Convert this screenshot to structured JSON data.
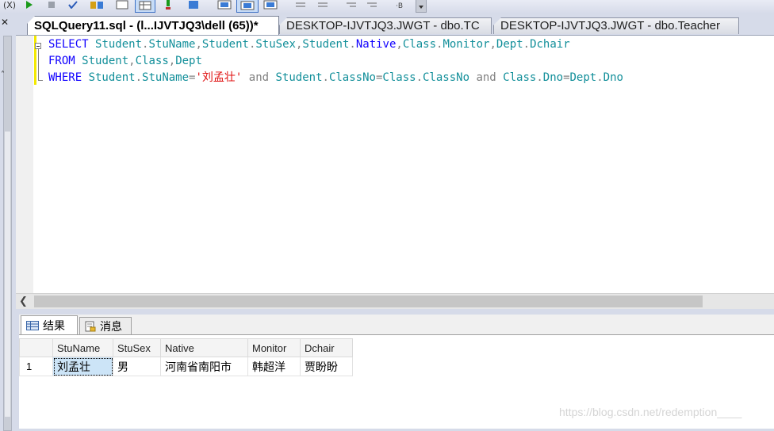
{
  "toolbar": {
    "cut_label": "(X)",
    "icons": [
      "execute-icon",
      "stop-icon",
      "parse-icon",
      "plan-icon",
      "results-to-text-icon",
      "results-to-grid-icon",
      "results-to-file-icon",
      "include-plan-icon",
      "comment-icon",
      "uncomment-icon",
      "decrease-indent-icon",
      "increase-indent-icon",
      "specify-values-icon"
    ]
  },
  "tabs": [
    {
      "label": "SQLQuery11.sql - (l...IJVTJQ3\\dell (65))*",
      "active": true
    },
    {
      "label": "DESKTOP-IJVTJQ3.JWGT - dbo.TC",
      "active": false
    },
    {
      "label": "DESKTOP-IJVTJQ3.JWGT - dbo.Teacher",
      "active": false
    }
  ],
  "editor": {
    "lines": [
      [
        {
          "t": "SELECT ",
          "c": "kw"
        },
        {
          "t": "Student",
          "c": "id"
        },
        {
          "t": ".",
          "c": "op"
        },
        {
          "t": "StuName",
          "c": "id"
        },
        {
          "t": ",",
          "c": "op"
        },
        {
          "t": "Student",
          "c": "id"
        },
        {
          "t": ".",
          "c": "op"
        },
        {
          "t": "StuSex",
          "c": "id"
        },
        {
          "t": ",",
          "c": "op"
        },
        {
          "t": "Student",
          "c": "id"
        },
        {
          "t": ".",
          "c": "op"
        },
        {
          "t": "Native",
          "c": "kw"
        },
        {
          "t": ",",
          "c": "op"
        },
        {
          "t": "Class",
          "c": "id"
        },
        {
          "t": ".",
          "c": "op"
        },
        {
          "t": "Monitor",
          "c": "id"
        },
        {
          "t": ",",
          "c": "op"
        },
        {
          "t": "Dept",
          "c": "id"
        },
        {
          "t": ".",
          "c": "op"
        },
        {
          "t": "Dchair",
          "c": "id"
        }
      ],
      [
        {
          "t": "FROM ",
          "c": "kw"
        },
        {
          "t": "Student",
          "c": "id"
        },
        {
          "t": ",",
          "c": "op"
        },
        {
          "t": "Class",
          "c": "id"
        },
        {
          "t": ",",
          "c": "op"
        },
        {
          "t": "Dept",
          "c": "id"
        }
      ],
      [
        {
          "t": "WHERE ",
          "c": "kw"
        },
        {
          "t": "Student",
          "c": "id"
        },
        {
          "t": ".",
          "c": "op"
        },
        {
          "t": "StuName",
          "c": "id"
        },
        {
          "t": "=",
          "c": "op"
        },
        {
          "t": "'刘孟壮'",
          "c": "str"
        },
        {
          "t": " and ",
          "c": "op"
        },
        {
          "t": "Student",
          "c": "id"
        },
        {
          "t": ".",
          "c": "op"
        },
        {
          "t": "ClassNo",
          "c": "id"
        },
        {
          "t": "=",
          "c": "op"
        },
        {
          "t": "Class",
          "c": "id"
        },
        {
          "t": ".",
          "c": "op"
        },
        {
          "t": "ClassNo",
          "c": "id"
        },
        {
          "t": " and ",
          "c": "op"
        },
        {
          "t": "Class",
          "c": "id"
        },
        {
          "t": ".",
          "c": "op"
        },
        {
          "t": "Dno",
          "c": "id"
        },
        {
          "t": "=",
          "c": "op"
        },
        {
          "t": "Dept",
          "c": "id"
        },
        {
          "t": ".",
          "c": "op"
        },
        {
          "t": "Dno",
          "c": "id"
        }
      ]
    ]
  },
  "results_tabs": {
    "results_label": "结果",
    "messages_label": "消息"
  },
  "grid": {
    "columns": [
      "StuName",
      "StuSex",
      "Native",
      "Monitor",
      "Dchair"
    ],
    "rows": [
      {
        "num": "1",
        "cells": [
          "刘孟壮",
          "男",
          "河南省南阳市",
          "韩超洋",
          "贾盼盼"
        ]
      }
    ]
  },
  "watermark": "https://blog.csdn.net/redemption____",
  "colors": {
    "keyword": "#1000ff",
    "identifier": "#128f9a",
    "operator": "#808080",
    "string": "#e01010",
    "chrome": "#d6dbe9"
  }
}
